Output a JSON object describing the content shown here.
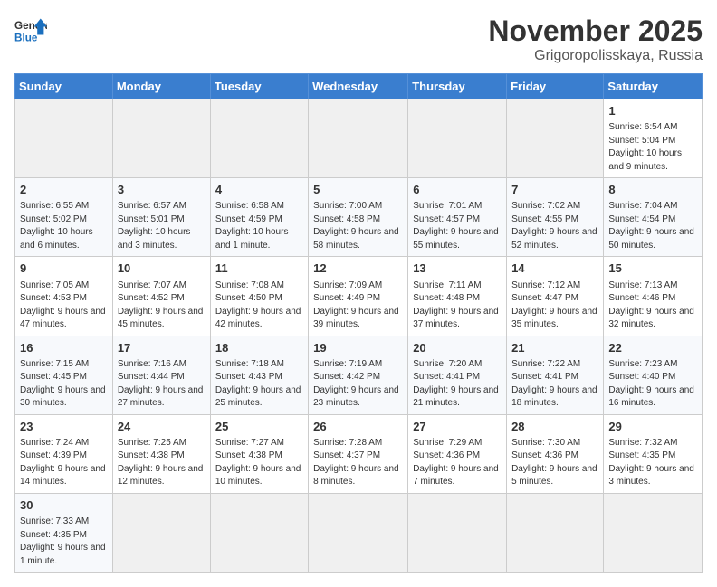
{
  "header": {
    "logo_general": "General",
    "logo_blue": "Blue",
    "month": "November 2025",
    "location": "Grigoropolisskaya, Russia"
  },
  "weekdays": [
    "Sunday",
    "Monday",
    "Tuesday",
    "Wednesday",
    "Thursday",
    "Friday",
    "Saturday"
  ],
  "weeks": [
    [
      {
        "day": "",
        "info": ""
      },
      {
        "day": "",
        "info": ""
      },
      {
        "day": "",
        "info": ""
      },
      {
        "day": "",
        "info": ""
      },
      {
        "day": "",
        "info": ""
      },
      {
        "day": "",
        "info": ""
      },
      {
        "day": "1",
        "info": "Sunrise: 6:54 AM\nSunset: 5:04 PM\nDaylight: 10 hours and 9 minutes."
      }
    ],
    [
      {
        "day": "2",
        "info": "Sunrise: 6:55 AM\nSunset: 5:02 PM\nDaylight: 10 hours and 6 minutes."
      },
      {
        "day": "3",
        "info": "Sunrise: 6:57 AM\nSunset: 5:01 PM\nDaylight: 10 hours and 3 minutes."
      },
      {
        "day": "4",
        "info": "Sunrise: 6:58 AM\nSunset: 4:59 PM\nDaylight: 10 hours and 1 minute."
      },
      {
        "day": "5",
        "info": "Sunrise: 7:00 AM\nSunset: 4:58 PM\nDaylight: 9 hours and 58 minutes."
      },
      {
        "day": "6",
        "info": "Sunrise: 7:01 AM\nSunset: 4:57 PM\nDaylight: 9 hours and 55 minutes."
      },
      {
        "day": "7",
        "info": "Sunrise: 7:02 AM\nSunset: 4:55 PM\nDaylight: 9 hours and 52 minutes."
      },
      {
        "day": "8",
        "info": "Sunrise: 7:04 AM\nSunset: 4:54 PM\nDaylight: 9 hours and 50 minutes."
      }
    ],
    [
      {
        "day": "9",
        "info": "Sunrise: 7:05 AM\nSunset: 4:53 PM\nDaylight: 9 hours and 47 minutes."
      },
      {
        "day": "10",
        "info": "Sunrise: 7:07 AM\nSunset: 4:52 PM\nDaylight: 9 hours and 45 minutes."
      },
      {
        "day": "11",
        "info": "Sunrise: 7:08 AM\nSunset: 4:50 PM\nDaylight: 9 hours and 42 minutes."
      },
      {
        "day": "12",
        "info": "Sunrise: 7:09 AM\nSunset: 4:49 PM\nDaylight: 9 hours and 39 minutes."
      },
      {
        "day": "13",
        "info": "Sunrise: 7:11 AM\nSunset: 4:48 PM\nDaylight: 9 hours and 37 minutes."
      },
      {
        "day": "14",
        "info": "Sunrise: 7:12 AM\nSunset: 4:47 PM\nDaylight: 9 hours and 35 minutes."
      },
      {
        "day": "15",
        "info": "Sunrise: 7:13 AM\nSunset: 4:46 PM\nDaylight: 9 hours and 32 minutes."
      }
    ],
    [
      {
        "day": "16",
        "info": "Sunrise: 7:15 AM\nSunset: 4:45 PM\nDaylight: 9 hours and 30 minutes."
      },
      {
        "day": "17",
        "info": "Sunrise: 7:16 AM\nSunset: 4:44 PM\nDaylight: 9 hours and 27 minutes."
      },
      {
        "day": "18",
        "info": "Sunrise: 7:18 AM\nSunset: 4:43 PM\nDaylight: 9 hours and 25 minutes."
      },
      {
        "day": "19",
        "info": "Sunrise: 7:19 AM\nSunset: 4:42 PM\nDaylight: 9 hours and 23 minutes."
      },
      {
        "day": "20",
        "info": "Sunrise: 7:20 AM\nSunset: 4:41 PM\nDaylight: 9 hours and 21 minutes."
      },
      {
        "day": "21",
        "info": "Sunrise: 7:22 AM\nSunset: 4:41 PM\nDaylight: 9 hours and 18 minutes."
      },
      {
        "day": "22",
        "info": "Sunrise: 7:23 AM\nSunset: 4:40 PM\nDaylight: 9 hours and 16 minutes."
      }
    ],
    [
      {
        "day": "23",
        "info": "Sunrise: 7:24 AM\nSunset: 4:39 PM\nDaylight: 9 hours and 14 minutes."
      },
      {
        "day": "24",
        "info": "Sunrise: 7:25 AM\nSunset: 4:38 PM\nDaylight: 9 hours and 12 minutes."
      },
      {
        "day": "25",
        "info": "Sunrise: 7:27 AM\nSunset: 4:38 PM\nDaylight: 9 hours and 10 minutes."
      },
      {
        "day": "26",
        "info": "Sunrise: 7:28 AM\nSunset: 4:37 PM\nDaylight: 9 hours and 8 minutes."
      },
      {
        "day": "27",
        "info": "Sunrise: 7:29 AM\nSunset: 4:36 PM\nDaylight: 9 hours and 7 minutes."
      },
      {
        "day": "28",
        "info": "Sunrise: 7:30 AM\nSunset: 4:36 PM\nDaylight: 9 hours and 5 minutes."
      },
      {
        "day": "29",
        "info": "Sunrise: 7:32 AM\nSunset: 4:35 PM\nDaylight: 9 hours and 3 minutes."
      }
    ],
    [
      {
        "day": "30",
        "info": "Sunrise: 7:33 AM\nSunset: 4:35 PM\nDaylight: 9 hours and 1 minute."
      },
      {
        "day": "",
        "info": ""
      },
      {
        "day": "",
        "info": ""
      },
      {
        "day": "",
        "info": ""
      },
      {
        "day": "",
        "info": ""
      },
      {
        "day": "",
        "info": ""
      },
      {
        "day": "",
        "info": ""
      }
    ]
  ]
}
